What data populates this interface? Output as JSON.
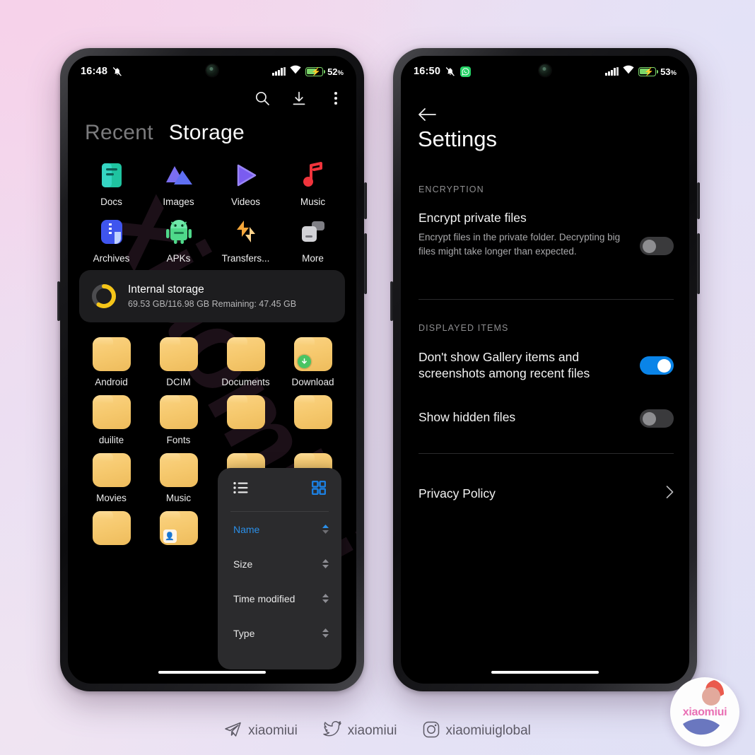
{
  "phone_left": {
    "status_bar": {
      "time": "16:48",
      "mute_icon": "bell-muted-icon",
      "signal_icon": "cellular-signal-icon",
      "wifi_icon": "wifi-icon",
      "battery_icon": "battery-charging-icon",
      "battery_percent": "52",
      "battery_percent_symbol": "%"
    },
    "toolbar": {
      "search_label": "search-icon",
      "download_label": "download-icon",
      "more_label": "more-options-icon"
    },
    "tabs": [
      {
        "label": "Recent",
        "active": false
      },
      {
        "label": "Storage",
        "active": true
      }
    ],
    "categories": [
      {
        "label": "Docs",
        "icon": "document-icon"
      },
      {
        "label": "Images",
        "icon": "image-icon"
      },
      {
        "label": "Videos",
        "icon": "video-play-icon"
      },
      {
        "label": "Music",
        "icon": "music-note-icon"
      },
      {
        "label": "Archives",
        "icon": "archive-zip-icon"
      },
      {
        "label": "APKs",
        "icon": "android-robot-icon"
      },
      {
        "label": "Transfers...",
        "icon": "transfer-arrows-icon"
      },
      {
        "label": "More",
        "icon": "more-files-icon"
      }
    ],
    "storage_card": {
      "icon": "storage-ring-icon",
      "title": "Internal storage",
      "subtitle": "69.53 GB/116.98 GB  Remaining: 47.45 GB",
      "used_gb": 69.53,
      "total_gb": 116.98,
      "remaining_gb": 47.45,
      "used_percent": 59
    },
    "folders": [
      {
        "label": "Android",
        "badge": null
      },
      {
        "label": "DCIM",
        "badge": null
      },
      {
        "label": "Documents",
        "badge": null
      },
      {
        "label": "Download",
        "badge": "download-badge-icon"
      },
      {
        "label": "duilite",
        "badge": null
      },
      {
        "label": "Fonts",
        "badge": null
      },
      {
        "label": "",
        "badge": null
      },
      {
        "label": "",
        "badge": null
      },
      {
        "label": "Movies",
        "badge": null
      },
      {
        "label": "Music",
        "badge": null
      },
      {
        "label": "",
        "badge": null
      },
      {
        "label": "",
        "badge": null
      },
      {
        "label": "",
        "badge": null
      },
      {
        "label": "",
        "badge": "avatar-badge-icon"
      },
      {
        "label": "",
        "badge": null
      },
      {
        "label": "",
        "badge": null
      }
    ],
    "sort_popup": {
      "view_list_icon": "list-view-icon",
      "view_grid_icon": "grid-view-icon",
      "active_view": "grid",
      "options": [
        {
          "label": "Name",
          "selected": true,
          "direction": "asc"
        },
        {
          "label": "Size",
          "selected": false,
          "direction": "none"
        },
        {
          "label": "Time modified",
          "selected": false,
          "direction": "none"
        },
        {
          "label": "Type",
          "selected": false,
          "direction": "none"
        }
      ]
    }
  },
  "phone_right": {
    "status_bar": {
      "time": "16:50",
      "mute_icon": "bell-muted-icon",
      "app_icon": "whatsapp-icon",
      "signal_icon": "cellular-signal-icon",
      "wifi_icon": "wifi-icon",
      "battery_icon": "battery-charging-icon",
      "battery_percent": "53",
      "battery_percent_symbol": "%"
    },
    "back_icon": "back-arrow-icon",
    "title": "Settings",
    "sections": [
      {
        "header": "ENCRYPTION",
        "rows": [
          {
            "title": "Encrypt private files",
            "subtitle": "Encrypt files in the private folder. Decrypting big files might take longer than expected.",
            "toggle": "off"
          }
        ]
      },
      {
        "header": "DISPLAYED ITEMS",
        "rows": [
          {
            "title": "Don't show Gallery items and screenshots among recent files",
            "subtitle": "",
            "toggle": "on"
          },
          {
            "title": "Show hidden files",
            "subtitle": "",
            "toggle": "off"
          }
        ]
      }
    ],
    "privacy_policy": {
      "label": "Privacy Policy",
      "chevron": "chevron-right-icon"
    }
  },
  "watermark": {
    "text": "xiaomiui"
  },
  "footer": {
    "items": [
      {
        "icon": "telegram-icon",
        "label": "xiaomiui"
      },
      {
        "icon": "twitter-icon",
        "label": "xiaomiui"
      },
      {
        "icon": "instagram-icon",
        "label": "xiaomiuiglobal"
      }
    ]
  },
  "logo": {
    "text": "xiaomiui"
  },
  "colors": {
    "accent_blue": "#0a84e8",
    "folder_yellow": "#f6c96e",
    "battery_green": "#7bd66a",
    "storage_ring": "#f5c518",
    "brand_pink": "#e96fb4"
  }
}
